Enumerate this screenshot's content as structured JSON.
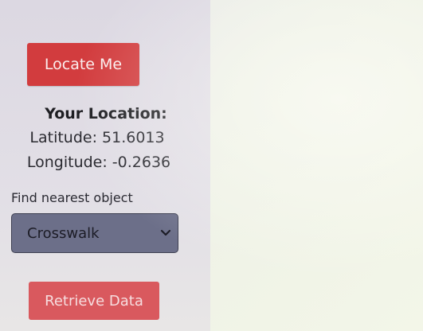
{
  "locate": {
    "button_label": "Locate Me"
  },
  "location": {
    "title": "Your Location:",
    "latitude": "Latitude: 51.6013",
    "longitude": "Longitude: -0.2636"
  },
  "find": {
    "label": "Find nearest object",
    "selected": "Crosswalk",
    "chevron_icon": "chevron-down-icon"
  },
  "retrieve": {
    "button_label": "Retrieve Data"
  },
  "colors": {
    "primary_button": "#d23c3e",
    "disabled_button": "#d9595e",
    "select_background": "#6c6f89"
  }
}
